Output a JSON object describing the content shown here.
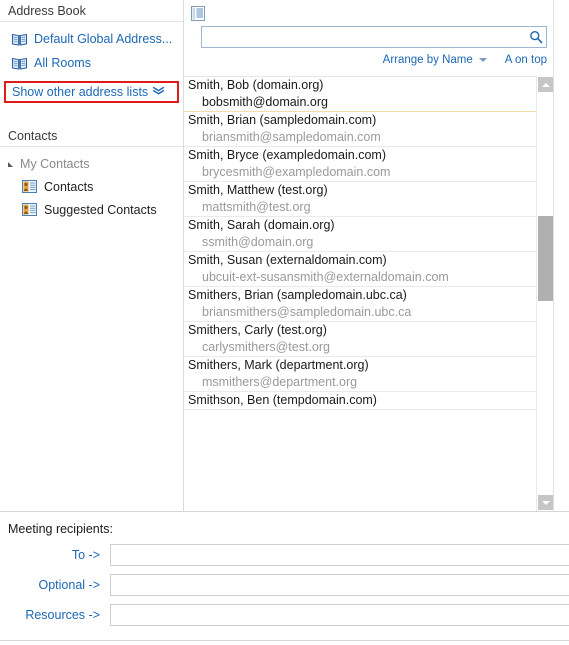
{
  "left_panel": {
    "address_book": {
      "header": "Address Book",
      "items": [
        {
          "label": "Default Global Address...",
          "icon": "book-icon"
        },
        {
          "label": "All Rooms",
          "icon": "book-icon"
        }
      ],
      "show_other": {
        "label": "Show other address lists",
        "chevron": "»",
        "highlight_color": "#e01b1b"
      }
    },
    "contacts": {
      "header": "Contacts",
      "root": "My Contacts",
      "children": [
        {
          "label": "Contacts",
          "icon": "contact-card-icon"
        },
        {
          "label": "Suggested Contacts",
          "icon": "contact-card-icon"
        }
      ]
    }
  },
  "right_panel": {
    "toolbar_icon": "address-list-icon",
    "search": {
      "value": "",
      "placeholder": "",
      "icon": "search-icon"
    },
    "arrange": {
      "by_label": "Arrange by Name",
      "order_label": "A on top"
    },
    "contacts": [
      {
        "name": "Smith, Bob (domain.org)",
        "email": "bobsmith@domain.org",
        "selected": true
      },
      {
        "name": "Smith, Brian (sampledomain.com)",
        "email": "briansmith@sampledomain.com",
        "selected": false
      },
      {
        "name": "Smith, Bryce (exampledomain.com)",
        "email": "brycesmith@exampledomain.com",
        "selected": false
      },
      {
        "name": "Smith, Matthew (test.org)",
        "email": "mattsmith@test.org",
        "selected": false
      },
      {
        "name": "Smith, Sarah (domain.org)",
        "email": "ssmith@domain.org",
        "selected": false
      },
      {
        "name": "Smith, Susan (externaldomain.com)",
        "email": "ubcuit-ext-susansmith@externaldomain.com",
        "selected": false
      },
      {
        "name": "Smithers, Brian (sampledomain.ubc.ca)",
        "email": "briansmithers@sampledomain.ubc.ca",
        "selected": false
      },
      {
        "name": "Smithers, Carly (test.org)",
        "email": "carlysmithers@test.org",
        "selected": false
      },
      {
        "name": "Smithers, Mark (department.org)",
        "email": "msmithers@department.org",
        "selected": false
      },
      {
        "name": "Smithson, Ben (tempdomain.com)",
        "email": "",
        "selected": false
      }
    ]
  },
  "bottom": {
    "title": "Meeting recipients:",
    "rows": [
      {
        "label": "To ->",
        "value": ""
      },
      {
        "label": "Optional ->",
        "value": ""
      },
      {
        "label": "Resources ->",
        "value": ""
      }
    ]
  },
  "colors": {
    "link": "#1d68b3",
    "selection_gold": "#ffd136",
    "highlight_red": "#e01b1b",
    "muted_text": "#9a9a9a"
  }
}
